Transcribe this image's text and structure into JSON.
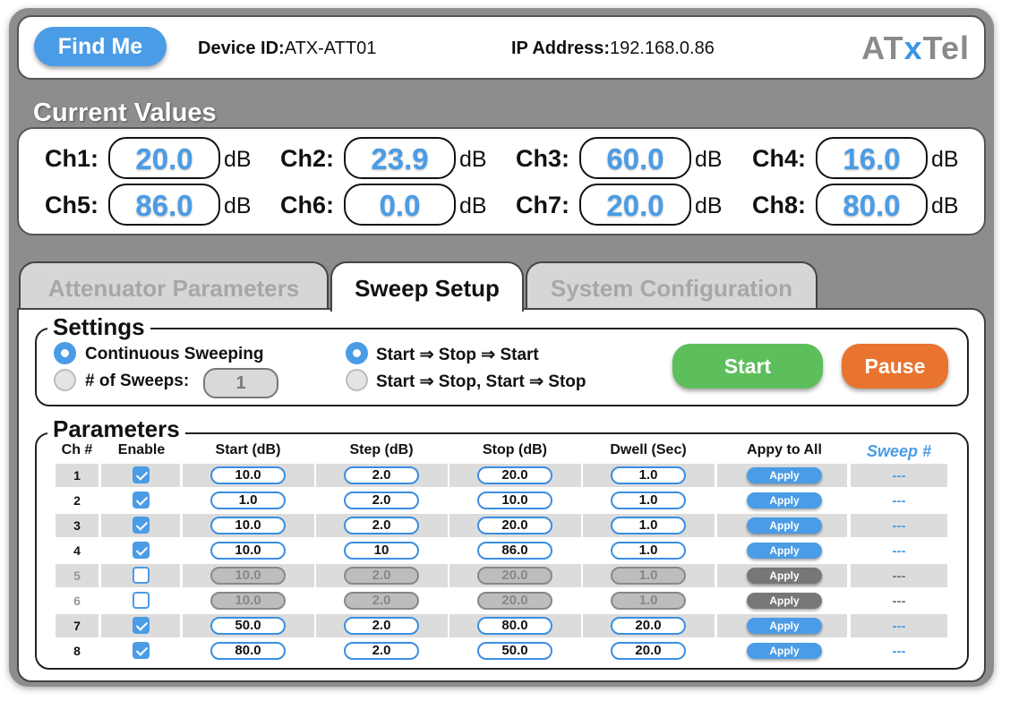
{
  "header": {
    "find_me": "Find Me",
    "device_id_label": "Device ID:",
    "device_id": "ATX-ATT01",
    "ip_label": "IP Address:",
    "ip": "192.168.0.86",
    "logo_left": "AT",
    "logo_x": "x",
    "logo_right": "Tel"
  },
  "current_values": {
    "title": "Current Values",
    "unit": "dB",
    "channels": [
      {
        "label": "Ch1:",
        "value": "20.0"
      },
      {
        "label": "Ch2:",
        "value": "23.9"
      },
      {
        "label": "Ch3:",
        "value": "60.0"
      },
      {
        "label": "Ch4:",
        "value": "16.0"
      },
      {
        "label": "Ch5:",
        "value": "86.0"
      },
      {
        "label": "Ch6:",
        "value": "0.0"
      },
      {
        "label": "Ch7:",
        "value": "20.0"
      },
      {
        "label": "Ch8:",
        "value": "80.0"
      }
    ]
  },
  "tabs": [
    {
      "label": "Attenuator Parameters",
      "active": false
    },
    {
      "label": "Sweep Setup",
      "active": true
    },
    {
      "label": "System Configuration",
      "active": false
    }
  ],
  "settings": {
    "title": "Settings",
    "continuous": "Continuous Sweeping",
    "num_sweeps": "# of Sweeps:",
    "num_sweeps_value": "1",
    "mode_a": "Start ⇒ Stop ⇒ Start",
    "mode_b": "Start ⇒ Stop, Start ⇒ Stop",
    "start": "Start",
    "pause": "Pause"
  },
  "parameters": {
    "title": "Parameters",
    "headers": [
      "Ch #",
      "Enable",
      "Start (dB)",
      "Step (dB)",
      "Stop (dB)",
      "Dwell (Sec)",
      "Appy to All",
      "Sweep #"
    ],
    "apply_label": "Apply",
    "rows": [
      {
        "ch": "1",
        "enabled": true,
        "start": "10.0",
        "step": "2.0",
        "stop": "20.0",
        "dwell": "1.0",
        "sweep": "---"
      },
      {
        "ch": "2",
        "enabled": true,
        "start": "1.0",
        "step": "2.0",
        "stop": "10.0",
        "dwell": "1.0",
        "sweep": "---"
      },
      {
        "ch": "3",
        "enabled": true,
        "start": "10.0",
        "step": "2.0",
        "stop": "20.0",
        "dwell": "1.0",
        "sweep": "---"
      },
      {
        "ch": "4",
        "enabled": true,
        "start": "10.0",
        "step": "10",
        "stop": "86.0",
        "dwell": "1.0",
        "sweep": "---"
      },
      {
        "ch": "5",
        "enabled": false,
        "start": "10.0",
        "step": "2.0",
        "stop": "20.0",
        "dwell": "1.0",
        "sweep": "---"
      },
      {
        "ch": "6",
        "enabled": false,
        "start": "10.0",
        "step": "2.0",
        "stop": "20.0",
        "dwell": "1.0",
        "sweep": "---"
      },
      {
        "ch": "7",
        "enabled": true,
        "start": "50.0",
        "step": "2.0",
        "stop": "80.0",
        "dwell": "20.0",
        "sweep": "---"
      },
      {
        "ch": "8",
        "enabled": true,
        "start": "80.0",
        "step": "2.0",
        "stop": "50.0",
        "dwell": "20.0",
        "sweep": "---"
      }
    ]
  },
  "colors": {
    "accent": "#4a9ce6",
    "start_button": "#5cbf5c",
    "pause_button": "#e8742f",
    "frame": "#8d8d8d"
  }
}
